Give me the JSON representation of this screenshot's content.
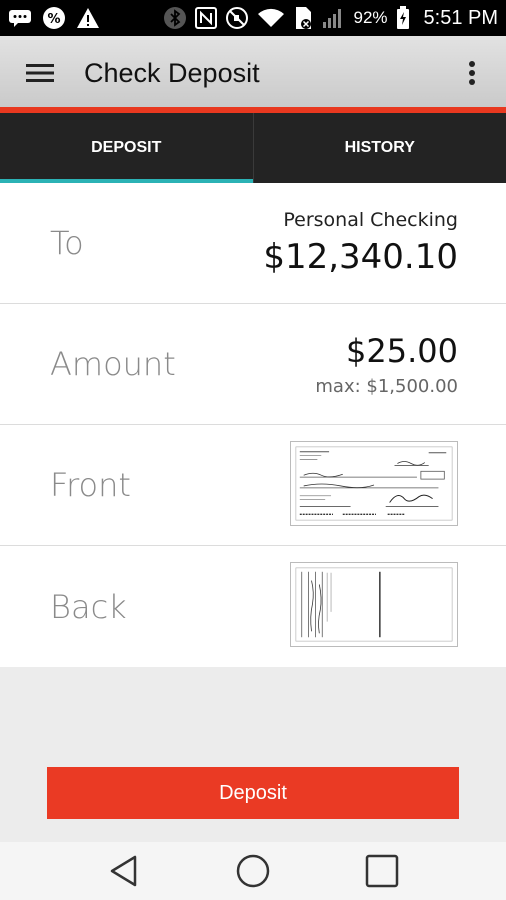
{
  "status_bar": {
    "battery_percent": "92%",
    "time": "5:51 PM",
    "icons": [
      "messages-icon",
      "percent-icon",
      "warning-icon",
      "bluetooth-icon",
      "nfc-icon",
      "mute-icon",
      "wifi-icon",
      "sim-icon",
      "signal-icon",
      "battery-icon"
    ]
  },
  "app_bar": {
    "title": "Check Deposit",
    "menu_icon": "hamburger-menu-icon",
    "overflow_icon": "more-vert-icon"
  },
  "tabs": [
    {
      "label": "DEPOSIT",
      "active": true
    },
    {
      "label": "HISTORY",
      "active": false
    }
  ],
  "form": {
    "to": {
      "label": "To",
      "account": "Personal Checking",
      "balance": "$12,340.10"
    },
    "amount": {
      "label": "Amount",
      "value": "$25.00",
      "max": "max: $1,500.00"
    },
    "front": {
      "label": "Front",
      "image": "check-front-image"
    },
    "back": {
      "label": "Back",
      "image": "check-back-image"
    }
  },
  "deposit_button": {
    "label": "Deposit"
  },
  "colors": {
    "accent": "#e8381f",
    "tab_indicator": "#2bb2b5",
    "tab_bg": "#232323",
    "button": "#ea3a24"
  },
  "nav_bar": {
    "icons": [
      "back-icon",
      "home-icon",
      "recents-icon"
    ]
  }
}
